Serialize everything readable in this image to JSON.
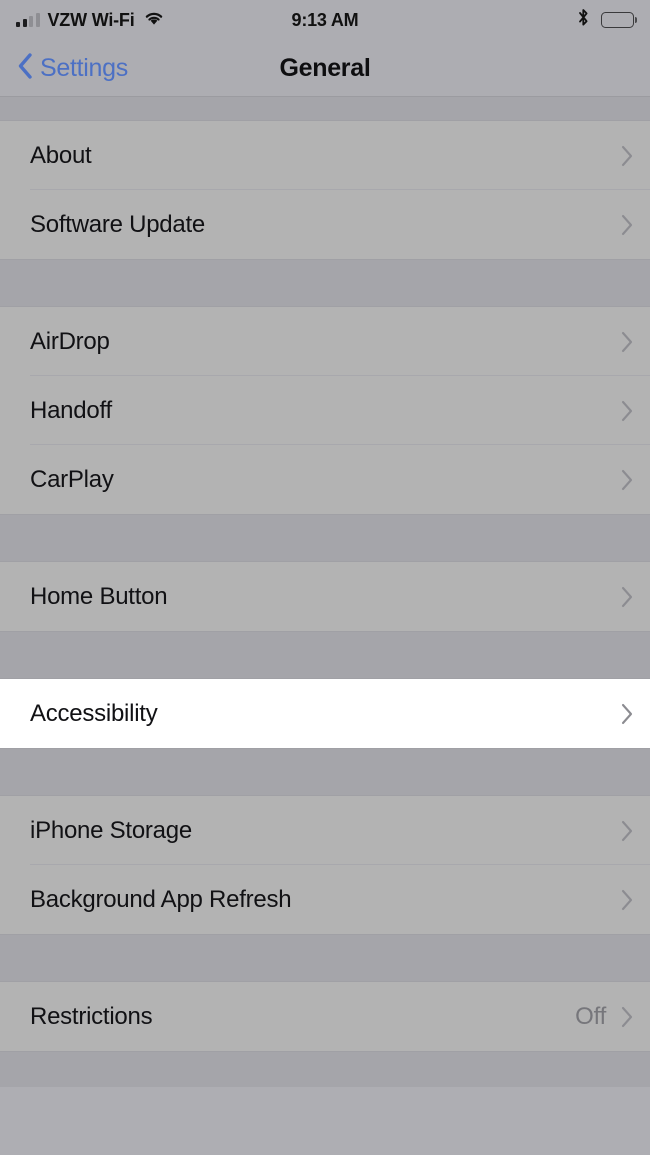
{
  "status_bar": {
    "carrier": "VZW Wi-Fi",
    "time": "9:13 AM",
    "signal_icon": "cellular-signal-icon",
    "wifi_icon": "wifi-icon",
    "bluetooth_icon": "bluetooth-icon",
    "battery_icon": "battery-full-icon"
  },
  "nav_bar": {
    "back_label": "Settings",
    "title": "General",
    "back_icon": "chevron-left-icon",
    "accent_color": "#4c70c4"
  },
  "colors": {
    "bar_background": "#adadb2",
    "group_gap": "#a5a5aa",
    "row_background": "#b3b3b3",
    "row_highlight": "#ffffff",
    "separator": "#a8a8ad",
    "label_text": "#111114",
    "value_text": "#76767b",
    "chevron": "#8c8c91"
  },
  "groups": [
    {
      "rows": [
        {
          "label": "About",
          "value": "",
          "highlighted": false,
          "chevron": "chevron-right-icon"
        },
        {
          "label": "Software Update",
          "value": "",
          "highlighted": false,
          "chevron": "chevron-right-icon"
        }
      ]
    },
    {
      "rows": [
        {
          "label": "AirDrop",
          "value": "",
          "highlighted": false,
          "chevron": "chevron-right-icon"
        },
        {
          "label": "Handoff",
          "value": "",
          "highlighted": false,
          "chevron": "chevron-right-icon"
        },
        {
          "label": "CarPlay",
          "value": "",
          "highlighted": false,
          "chevron": "chevron-right-icon"
        }
      ]
    },
    {
      "rows": [
        {
          "label": "Home Button",
          "value": "",
          "highlighted": false,
          "chevron": "chevron-right-icon"
        }
      ]
    },
    {
      "rows": [
        {
          "label": "Accessibility",
          "value": "",
          "highlighted": true,
          "chevron": "chevron-right-icon"
        }
      ]
    },
    {
      "rows": [
        {
          "label": "iPhone Storage",
          "value": "",
          "highlighted": false,
          "chevron": "chevron-right-icon"
        },
        {
          "label": "Background App Refresh",
          "value": "",
          "highlighted": false,
          "chevron": "chevron-right-icon"
        }
      ]
    },
    {
      "rows": [
        {
          "label": "Restrictions",
          "value": "Off",
          "highlighted": false,
          "chevron": "chevron-right-icon"
        }
      ]
    }
  ]
}
